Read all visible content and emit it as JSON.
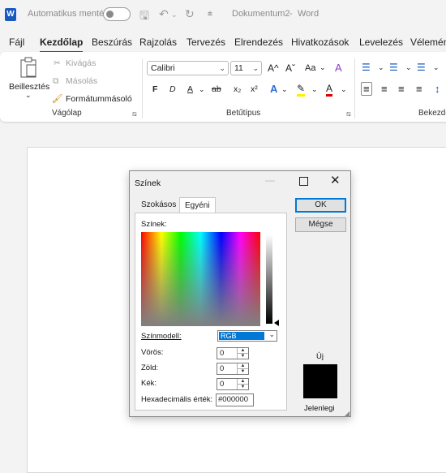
{
  "titlebar": {
    "autosave_label": "Automatikus mentés",
    "document_title": "Dokumentum2",
    "separator": "-",
    "app_name": "Word"
  },
  "menu": {
    "tabs": [
      "Fájl",
      "Kezdőlap",
      "Beszúrás",
      "Rajzolás",
      "Tervezés",
      "Elrendezés",
      "Hivatkozások",
      "Levelezés",
      "Vélemény"
    ],
    "active_tab": "Kezdőlap"
  },
  "ribbon": {
    "clipboard": {
      "paste": "Beillesztés",
      "cut": "Kivágás",
      "copy": "Másolás",
      "format_painter": "Formátummásoló",
      "group_label": "Vágólap"
    },
    "font": {
      "font_name": "Calibri",
      "font_size": "11",
      "bold": "F",
      "italic": "D",
      "underline": "A",
      "strikethrough": "ab",
      "subscript": "x₂",
      "superscript": "x²",
      "grow": "A^",
      "shrink": "Aˇ",
      "case": "Aa",
      "group_label": "Betűtípus"
    },
    "paragraph": {
      "group_label": "Bekezdés"
    }
  },
  "dialog": {
    "title": "Színek",
    "tabs": [
      "Szokásos",
      "Egyéni"
    ],
    "active_tab": "Egyéni",
    "colors_label": "Színek:",
    "color_model_label": "Színmodell:",
    "color_model_value": "RGB",
    "red_label": "Vörös:",
    "red_value": "0",
    "green_label": "Zöld:",
    "green_value": "0",
    "blue_label": "Kék:",
    "blue_value": "0",
    "hex_label": "Hexadecimális érték:",
    "hex_value": "#000000",
    "ok_label": "OK",
    "cancel_label": "Mégse",
    "new_label": "Új",
    "current_label": "Jelenlegi",
    "swatch_color": "#000000"
  },
  "colors": {
    "accent": "#185abd",
    "selection": "#0078d7"
  }
}
